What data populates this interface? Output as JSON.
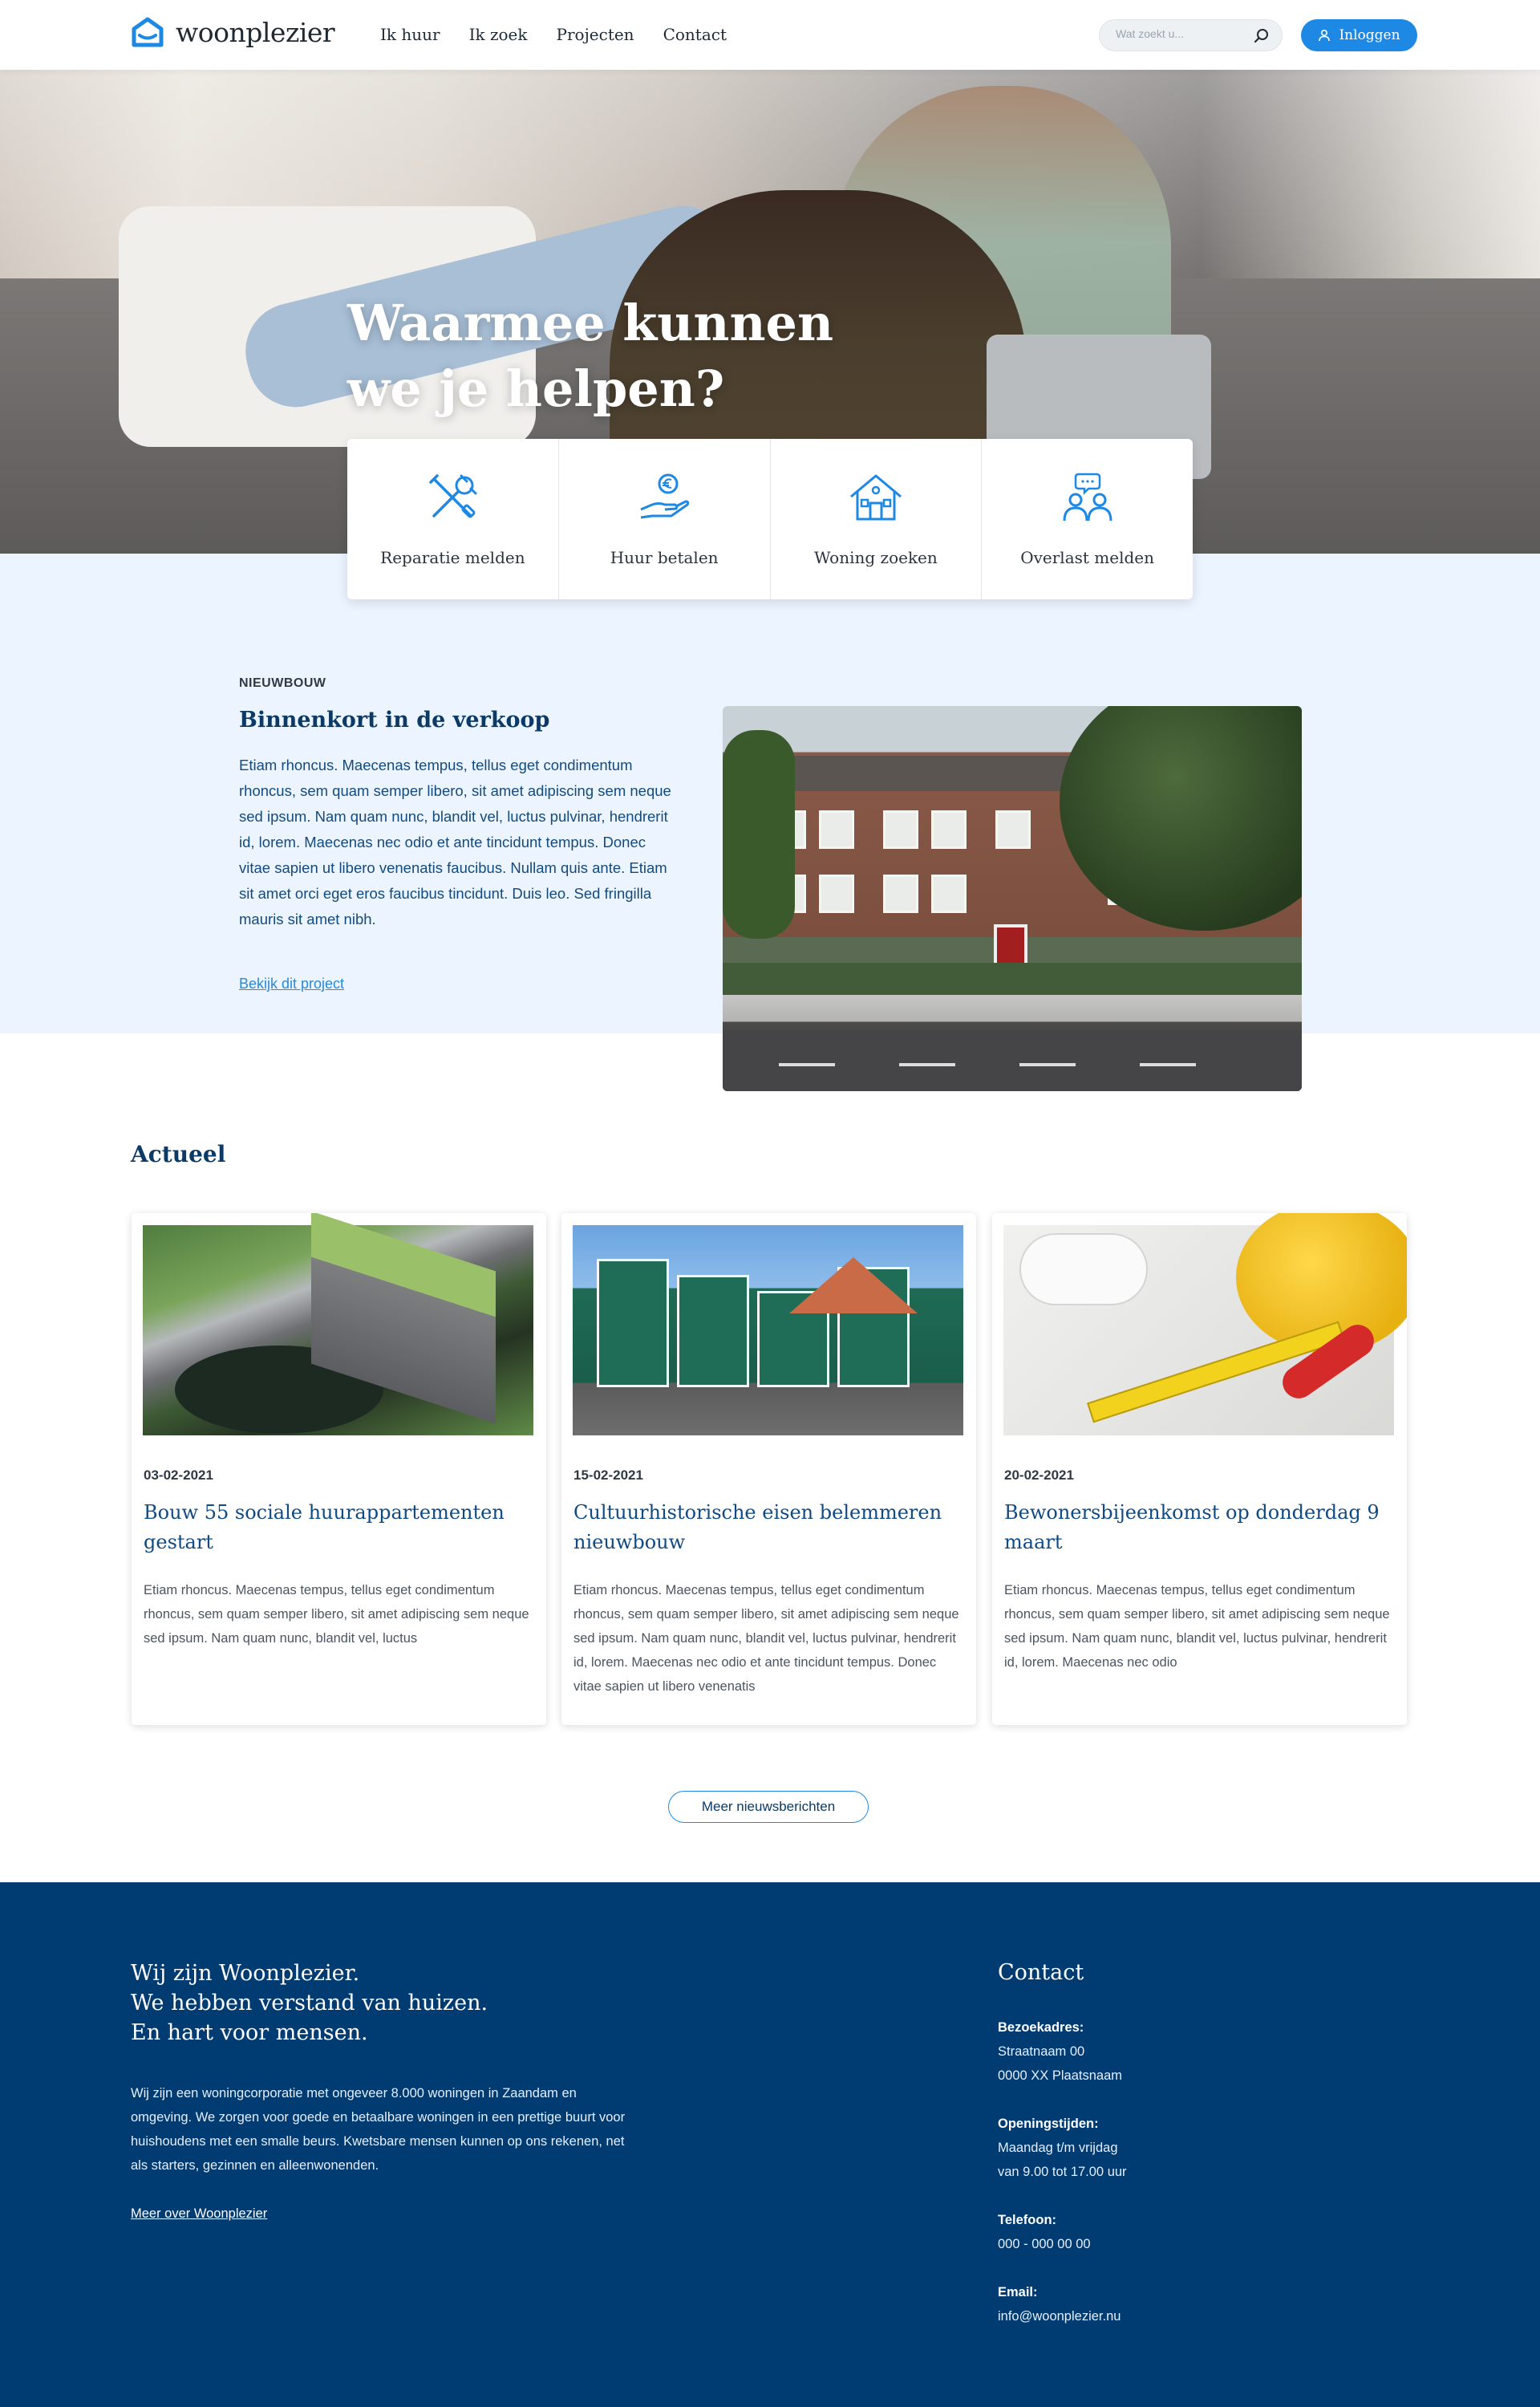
{
  "brand": {
    "name": "woonplezier",
    "accent": "#1e88e5",
    "navy": "#003b72"
  },
  "nav": {
    "items": [
      "Ik huur",
      "Ik zoek",
      "Projecten",
      "Contact"
    ]
  },
  "search": {
    "placeholder": "Wat zoekt u..."
  },
  "login": {
    "label": "Inloggen"
  },
  "hero": {
    "title_line1": "Waarmee kunnen",
    "title_line2": "we je helpen?"
  },
  "services": [
    {
      "label": "Reparatie melden",
      "icon": "tools-icon"
    },
    {
      "label": "Huur betalen",
      "icon": "euro-hand-icon"
    },
    {
      "label": "Woning zoeken",
      "icon": "house-icon"
    },
    {
      "label": "Overlast melden",
      "icon": "people-chat-icon"
    }
  ],
  "nieuwbouw": {
    "eyebrow": "NIEUWBOUW",
    "title": "Binnenkort in de verkoop",
    "text": "Etiam rhoncus. Maecenas tempus, tellus eget condimentum rhoncus, sem quam semper libero, sit amet adipiscing sem neque sed ipsum. Nam quam nunc, blandit vel, luctus pulvinar, hendrerit id, lorem. Maecenas nec odio et ante tincidunt tempus. Donec vitae sapien ut libero venenatis faucibus. Nullam quis ante. Etiam sit amet orci eget eros faucibus tincidunt. Duis leo. Sed fringilla mauris sit amet nibh.",
    "link": "Bekijk dit project"
  },
  "actueel": {
    "title": "Actueel",
    "news": [
      {
        "date": "03-02-2021",
        "title": "Bouw 55 sociale huurappartementen gestart",
        "body": "Etiam rhoncus. Maecenas tempus, tellus eget condimentum rhoncus, sem quam semper libero, sit amet adipiscing sem neque sed ipsum. Nam quam nunc, blandit vel, luctus"
      },
      {
        "date": "15-02-2021",
        "title": "Cultuurhistorische eisen belemmeren nieuwbouw",
        "body": "Etiam rhoncus. Maecenas tempus, tellus eget condimentum rhoncus, sem quam semper libero, sit amet adipiscing sem neque sed ipsum. Nam quam nunc, blandit vel, luctus pulvinar, hendrerit id, lorem. Maecenas nec odio et ante tincidunt tempus. Donec vitae sapien ut libero venenatis"
      },
      {
        "date": "20-02-2021",
        "title": "Bewonersbijeenkomst op donderdag 9 maart",
        "body": "Etiam rhoncus. Maecenas tempus, tellus eget condimentum rhoncus, sem quam semper libero, sit amet adipiscing sem neque sed ipsum. Nam quam nunc, blandit vel, luctus pulvinar, hendrerit id, lorem. Maecenas nec odio"
      }
    ],
    "more_button": "Meer nieuwsberichten"
  },
  "footer": {
    "heading_line1": "Wij zijn Woonplezier.",
    "heading_line2": "We hebben verstand van huizen.",
    "heading_line3": "En hart voor mensen.",
    "text": "Wij zijn een woningcorporatie met ongeveer 8.000 woningen in Zaandam en omgeving. We zorgen voor goede en betaalbare woningen in een prettige buurt voor huishoudens met een smalle beurs. Kwetsbare mensen kunnen op ons rekenen, net als starters, gezinnen en alleenwonenden.",
    "link": "Meer over Woonplezier",
    "contact_title": "Contact",
    "visit_label": "Bezoekadres:",
    "visit_line1": "Straatnaam 00",
    "visit_line2": "0000 XX Plaatsnaam",
    "hours_label": "Openingstijden:",
    "hours_line1": "Maandag t/m vrijdag",
    "hours_line2": "van 9.00 tot 17.00 uur",
    "phone_label": "Telefoon:",
    "phone": "000 -  000 00 00",
    "email_label": "Email:",
    "email": "info@woonplezier.nu"
  }
}
